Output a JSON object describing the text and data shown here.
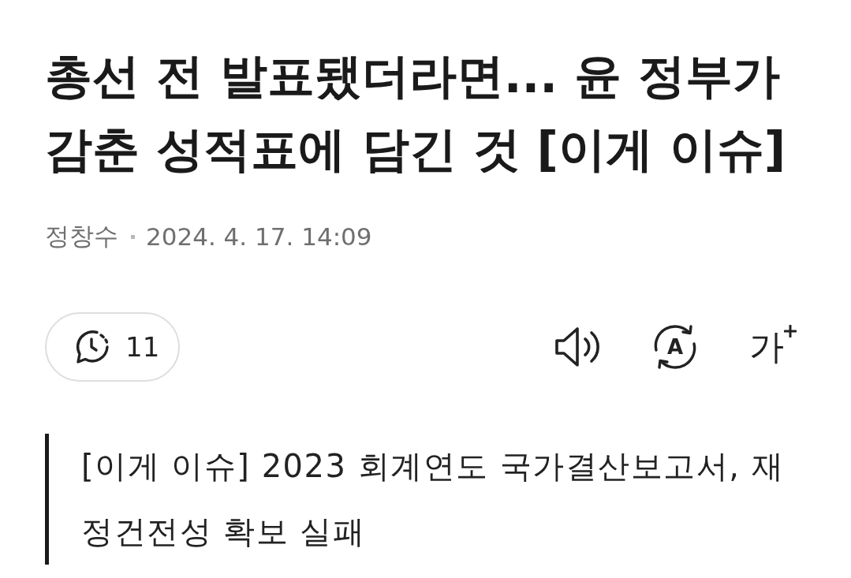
{
  "article": {
    "headline": "총선 전 발표됐더라면... 윤 정부가 감춘 성적표에 담긴 것 [이게 이슈]",
    "author": "정창수",
    "published": "2024. 4. 17. 14:09"
  },
  "toolbar": {
    "comments": {
      "count": "11"
    },
    "actions": [
      {
        "kind": "listen"
      },
      {
        "kind": "translate",
        "glyph": "A"
      },
      {
        "kind": "font_size",
        "glyph": "가"
      }
    ]
  },
  "summary": "[이게 이슈] 2023 회계연도 국가결산보고서, 재정건전성 확보 실패"
}
